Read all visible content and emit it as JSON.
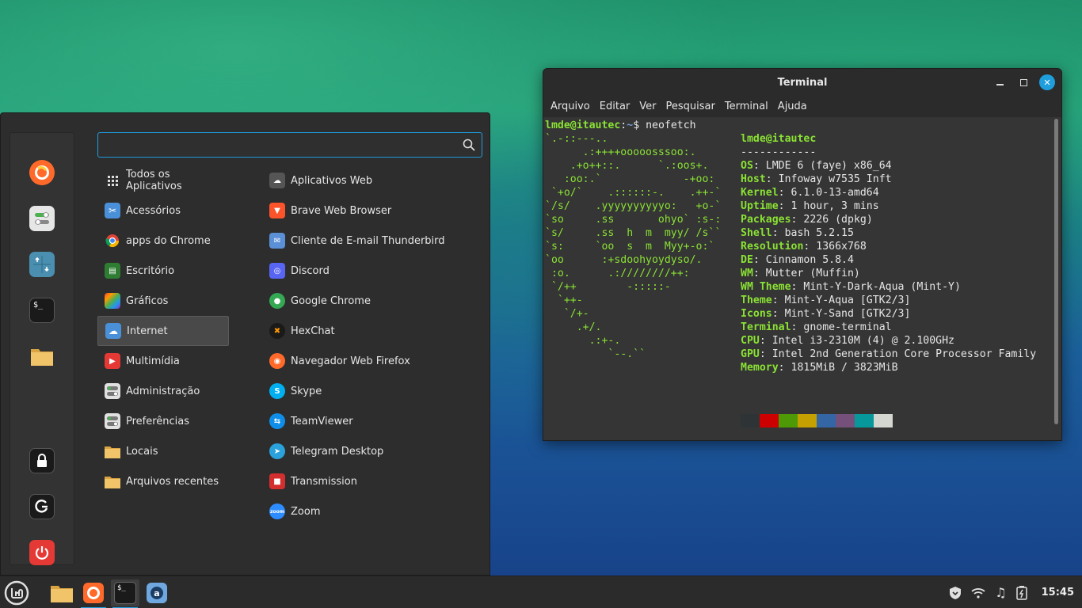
{
  "terminal": {
    "title": "Terminal",
    "menu": [
      "Arquivo",
      "Editar",
      "Ver",
      "Pesquisar",
      "Terminal",
      "Ajuda"
    ],
    "prompt_user": "lmde@itautec",
    "prompt_sep": ":",
    "prompt_path": "~",
    "prompt_symbol": "$ ",
    "command": "neofetch",
    "ascii_art": "`.-::---..\n      .:++++ooooosssoo:.\n    .+o++::.      `.:oos+.\n   :oo:.`             -+oo:\n `+o/`    .::::::-.    .++-`\n`/s/    .yyyyyyyyyyo:   +o-`\n`so     .ss       ohyo` :s-:\n`s/     .ss  h  m  myy/ /s``\n`s:     `oo  s  m  Myy+-o:`\n`oo      :+sdoohyoydyso/.\n :o.      .:////////++:\n `/++        -:::::-\n  `++-\n   `/+-\n     .+/.\n       .:+-.\n          `--.``",
    "user_host": "lmde@itautec",
    "separator": "------------",
    "info": [
      {
        "key": "OS",
        "value": "LMDE 6 (faye) x86_64"
      },
      {
        "key": "Host",
        "value": "Infoway w7535 Inft"
      },
      {
        "key": "Kernel",
        "value": "6.1.0-13-amd64"
      },
      {
        "key": "Uptime",
        "value": "1 hour, 3 mins"
      },
      {
        "key": "Packages",
        "value": "2226 (dpkg)"
      },
      {
        "key": "Shell",
        "value": "bash 5.2.15"
      },
      {
        "key": "Resolution",
        "value": "1366x768"
      },
      {
        "key": "DE",
        "value": "Cinnamon 5.8.4"
      },
      {
        "key": "WM",
        "value": "Mutter (Muffin)"
      },
      {
        "key": "WM Theme",
        "value": "Mint-Y-Dark-Aqua (Mint-Y)"
      },
      {
        "key": "Theme",
        "value": "Mint-Y-Aqua [GTK2/3]"
      },
      {
        "key": "Icons",
        "value": "Mint-Y-Sand [GTK2/3]"
      },
      {
        "key": "Terminal",
        "value": "gnome-terminal"
      },
      {
        "key": "CPU",
        "value": "Intel i3-2310M (4) @ 2.100GHz"
      },
      {
        "key": "GPU",
        "value": "Intel 2nd Generation Core Processor Family"
      },
      {
        "key": "Memory",
        "value": "1815MiB / 3823MiB"
      }
    ],
    "palette_top": [
      "#2e3436",
      "#cc0000",
      "#4e9a06",
      "#c4a000",
      "#3465a4",
      "#75507b",
      "#06989a",
      "#d3d7cf"
    ],
    "palette_bottom": [
      "#555753",
      "#ef2929",
      "#8ae234",
      "#fce94f",
      "#729fcf",
      "#ad7fa8",
      "#34e2e2",
      "#eeeeec"
    ]
  },
  "menu": {
    "search_value": "",
    "favorites": [
      {
        "icon": "firefox-icon",
        "color": "#ff6a2b"
      },
      {
        "icon": "settings-toggle-icon",
        "color": "#e6e6e6"
      },
      {
        "icon": "update-manager-icon",
        "color": "#4a8fb0"
      },
      {
        "icon": "terminal-icon",
        "color": "#1a1a1a"
      },
      {
        "icon": "folder-icon",
        "color": "#f2c46a"
      }
    ],
    "session": [
      {
        "icon": "lock-icon",
        "color": "#1a1a1a"
      },
      {
        "icon": "logout-icon",
        "color": "#1a1a1a"
      },
      {
        "icon": "power-icon",
        "color": "#e53935"
      }
    ],
    "categories": [
      {
        "label": "Todos os Aplicativos",
        "icon": "grid-icon",
        "color": "transparent"
      },
      {
        "label": "Acessórios",
        "icon": "scissors-icon",
        "color": "#4a90d9"
      },
      {
        "label": "apps do Chrome",
        "icon": "chrome-icon",
        "color": "#e8e8e8"
      },
      {
        "label": "Escritório",
        "icon": "office-icon",
        "color": "#2e7d32"
      },
      {
        "label": "Gráficos",
        "icon": "graphics-icon",
        "color": "#9c27b0"
      },
      {
        "label": "Internet",
        "icon": "cloud-icon",
        "color": "#4a90d9"
      },
      {
        "label": "Multimídia",
        "icon": "play-icon",
        "color": "#e53935"
      },
      {
        "label": "Administração",
        "icon": "admin-icon",
        "color": "#e0e0e0"
      },
      {
        "label": "Preferências",
        "icon": "preferences-icon",
        "color": "#e0e0e0"
      },
      {
        "label": "Locais",
        "icon": "folder-icon",
        "color": "#f2c46a"
      },
      {
        "label": "Arquivos recentes",
        "icon": "recent-folder-icon",
        "color": "#f2c46a"
      }
    ],
    "active_category": 5,
    "apps": [
      {
        "label": "Aplicativos Web",
        "icon": "webapps-icon",
        "color": "#555555",
        "glyph": "☁"
      },
      {
        "label": "Brave Web Browser",
        "icon": "brave-icon",
        "color": "#fb542b",
        "glyph": "▼"
      },
      {
        "label": "Cliente de E-mail Thunderbird",
        "icon": "mail-icon",
        "color": "#5b8fd6",
        "glyph": "✉"
      },
      {
        "label": "Discord",
        "icon": "discord-icon",
        "color": "#5865f2",
        "glyph": "◎"
      },
      {
        "label": "Google Chrome",
        "icon": "chrome-icon",
        "color": "#34a853",
        "glyph": "●"
      },
      {
        "label": "HexChat",
        "icon": "hexchat-icon",
        "color": "#1a1a1a",
        "glyph": "✖"
      },
      {
        "label": "Navegador Web Firefox",
        "icon": "firefox-icon",
        "color": "#ff6a2b",
        "glyph": "◉"
      },
      {
        "label": "Skype",
        "icon": "skype-icon",
        "color": "#00aff0",
        "glyph": "S"
      },
      {
        "label": "TeamViewer",
        "icon": "teamviewer-icon",
        "color": "#0e8ee9",
        "glyph": "⇆"
      },
      {
        "label": "Telegram Desktop",
        "icon": "telegram-icon",
        "color": "#2aa1da",
        "glyph": "➤"
      },
      {
        "label": "Transmission",
        "icon": "transmission-icon",
        "color": "#d32f2f",
        "glyph": "■"
      },
      {
        "label": "Zoom",
        "icon": "zoom-icon",
        "color": "#2d8cff",
        "glyph": "zoom"
      }
    ]
  },
  "taskbar": {
    "menu_button": "mint-logo-icon",
    "items": [
      {
        "icon": "folder-icon"
      },
      {
        "icon": "firefox-icon"
      },
      {
        "icon": "terminal-icon"
      },
      {
        "icon": "appimage-icon"
      }
    ],
    "clock": "15:45"
  }
}
